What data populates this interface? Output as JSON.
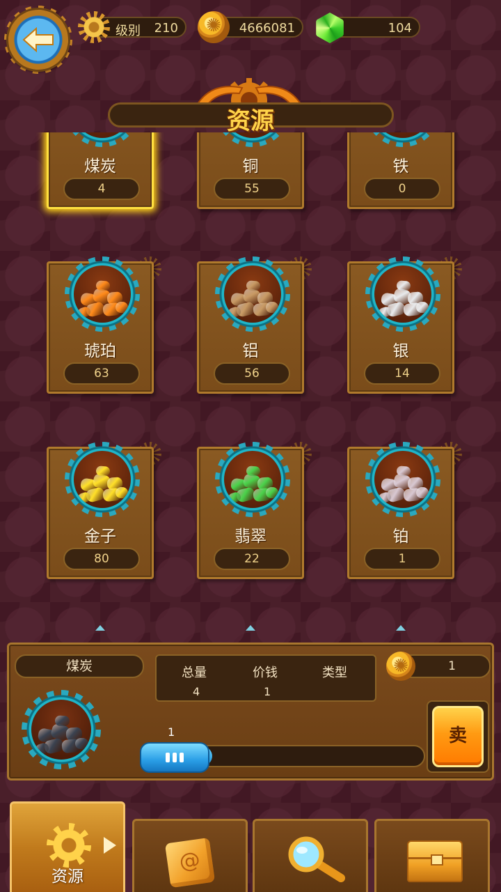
{
  "header": {
    "level_label": "级别",
    "level_value": "210",
    "coins": "4666081",
    "gems": "104",
    "title": "资源"
  },
  "resources": [
    {
      "name": "煤炭",
      "count": "4",
      "ore_color": "#3a4250",
      "selected": true
    },
    {
      "name": "铜",
      "count": "55",
      "ore_color": "#e8a890",
      "selected": false
    },
    {
      "name": "铁",
      "count": "0",
      "ore_color": "#e0c0b8",
      "selected": false
    },
    {
      "name": "琥珀",
      "count": "63",
      "ore_color": "#ff8a1a",
      "selected": false
    },
    {
      "name": "铝",
      "count": "56",
      "ore_color": "#c89a64",
      "selected": false
    },
    {
      "name": "银",
      "count": "14",
      "ore_color": "#e8eaec",
      "selected": false
    },
    {
      "name": "金子",
      "count": "80",
      "ore_color": "#ffe028",
      "selected": false
    },
    {
      "name": "翡翠",
      "count": "22",
      "ore_color": "#4ad24a",
      "selected": false
    },
    {
      "name": "铂",
      "count": "1",
      "ore_color": "#d8c8d2",
      "selected": false
    }
  ],
  "detail": {
    "name": "煤炭",
    "total_header": "总量",
    "price_header": "价钱",
    "type_header": "类型",
    "total_value": "4",
    "price_value": "1",
    "sell_price": "1",
    "quantity": "1",
    "slider_fraction": 0.25,
    "sell_label": "卖"
  },
  "tabs": {
    "resources_label": "资源"
  },
  "colors": {
    "background": "#4a1f2a",
    "panel": "#7a4a1c",
    "accent": "#ffd44a",
    "teal_ring": "#1fb5c8"
  }
}
